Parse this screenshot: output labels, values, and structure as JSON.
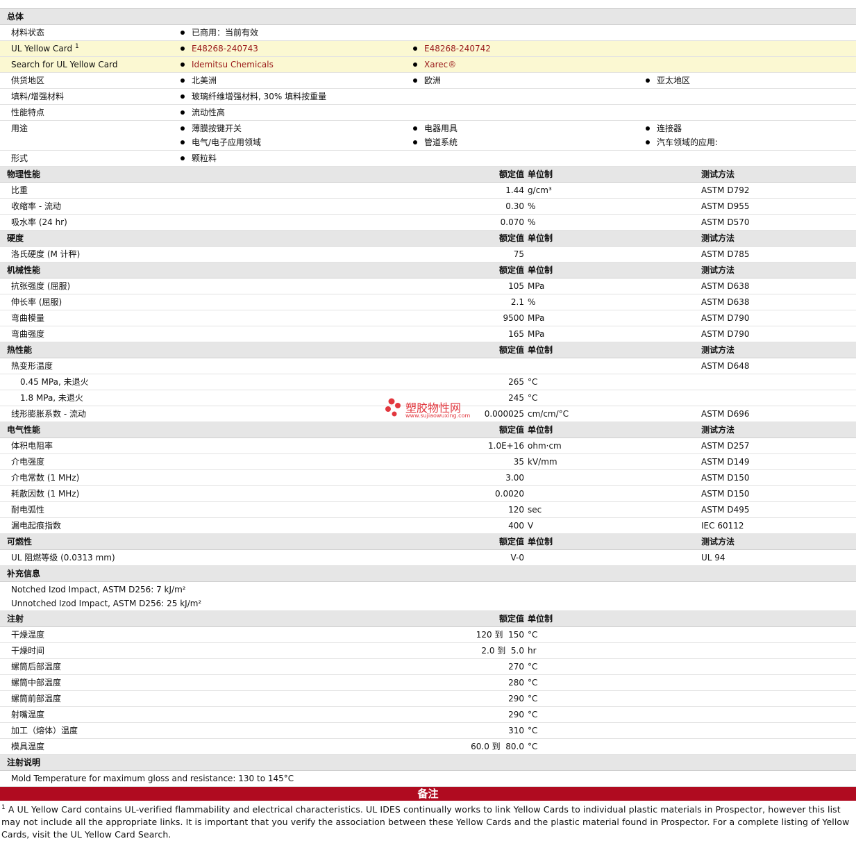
{
  "general": {
    "title": "总体",
    "material_status_label": "材料状态",
    "material_status": "已商用：当前有效",
    "ul_card_label": "UL Yellow Card",
    "ul_card_sup": "1",
    "ul_card_1": "E48268-240743",
    "ul_card_2": "E48268-240742",
    "search_label": "Search for UL Yellow Card",
    "search_1": "Idemitsu Chemicals",
    "search_2": "Xarec®",
    "supply_label": "供货地区",
    "supply": [
      "北美洲",
      "欧洲",
      "亚太地区"
    ],
    "filler_label": "填料/增强材料",
    "filler": "玻璃纤维增强材料, 30% 填料按重量",
    "features_label": "性能特点",
    "features": "流动性高",
    "uses_label": "用途",
    "uses": [
      "薄膜按键开关",
      "电器用具",
      "连接器",
      "电气/电子应用领域",
      "管道系统",
      "汽车领域的应用:"
    ],
    "form_label": "形式",
    "form": "颗粒料"
  },
  "headers": {
    "value": "额定值",
    "unit": "单位制",
    "method": "测试方法"
  },
  "physical": {
    "title": "物理性能",
    "rows": [
      {
        "name": "比重",
        "value": "1.44",
        "unit": "g/cm³",
        "method": "ASTM D792"
      },
      {
        "name": "收缩率 - 流动",
        "value": "0.30",
        "unit": "%",
        "method": "ASTM D955"
      },
      {
        "name": "吸水率 (24 hr)",
        "value": "0.070",
        "unit": "%",
        "method": "ASTM D570"
      }
    ]
  },
  "hardness": {
    "title": "硬度",
    "rows": [
      {
        "name": "洛氏硬度 (M 计秤)",
        "value": "75",
        "unit": "",
        "method": "ASTM D785"
      }
    ]
  },
  "mechanical": {
    "title": "机械性能",
    "rows": [
      {
        "name": "抗张强度 (屈服)",
        "value": "105",
        "unit": "MPa",
        "method": "ASTM D638"
      },
      {
        "name": "伸长率 (屈服)",
        "value": "2.1",
        "unit": "%",
        "method": "ASTM D638"
      },
      {
        "name": "弯曲模量",
        "value": "9500",
        "unit": "MPa",
        "method": "ASTM D790"
      },
      {
        "name": "弯曲强度",
        "value": "165",
        "unit": "MPa",
        "method": "ASTM D790"
      }
    ]
  },
  "thermal": {
    "title": "热性能",
    "hdt_label": "热变形温度",
    "hdt_method": "ASTM D648",
    "hdt_rows": [
      {
        "name": "0.45 MPa, 未退火",
        "value": "265",
        "unit": "°C"
      },
      {
        "name": "1.8 MPa, 未退火",
        "value": "245",
        "unit": "°C"
      }
    ],
    "clte": {
      "name": "线形膨胀系数 - 流动",
      "value": "0.000025",
      "unit": "cm/cm/°C",
      "method": "ASTM D696"
    }
  },
  "electrical": {
    "title": "电气性能",
    "rows": [
      {
        "name": "体积电阻率",
        "value": "1.0E+16",
        "unit": "ohm·cm",
        "method": "ASTM D257"
      },
      {
        "name": "介电强度",
        "value": "35",
        "unit": "kV/mm",
        "method": "ASTM D149"
      },
      {
        "name": "介电常数 (1 MHz)",
        "value": "3.00",
        "unit": "",
        "method": "ASTM D150"
      },
      {
        "name": "耗散因数 (1 MHz)",
        "value": "0.0020",
        "unit": "",
        "method": "ASTM D150"
      },
      {
        "name": "耐电弧性",
        "value": "120",
        "unit": "sec",
        "method": "ASTM D495"
      },
      {
        "name": "漏电起痕指数",
        "value": "400",
        "unit": "V",
        "method": "IEC 60112"
      }
    ]
  },
  "flammability": {
    "title": "可燃性",
    "rows": [
      {
        "name": "UL 阻燃等级 (0.0313 mm)",
        "value": "V-0",
        "unit": "",
        "method": "UL 94"
      }
    ]
  },
  "supplemental": {
    "title": "补充信息",
    "lines": [
      "Notched Izod Impact, ASTM D256: 7 kJ/m²",
      "Unnotched Izod Impact, ASTM D256: 25 kJ/m²"
    ]
  },
  "injection": {
    "title": "注射",
    "rows": [
      {
        "name": "干燥温度",
        "value": "120 到  150",
        "unit": "°C"
      },
      {
        "name": "干燥时间",
        "value": "2.0 到  5.0",
        "unit": "hr"
      },
      {
        "name": "螺筒后部温度",
        "value": "270",
        "unit": "°C"
      },
      {
        "name": "螺筒中部温度",
        "value": "280",
        "unit": "°C"
      },
      {
        "name": "螺筒前部温度",
        "value": "290",
        "unit": "°C"
      },
      {
        "name": "射嘴温度",
        "value": "290",
        "unit": "°C"
      },
      {
        "name": "加工（熔体）温度",
        "value": "310",
        "unit": "°C"
      },
      {
        "name": "模具温度",
        "value": "60.0 到  80.0",
        "unit": "°C"
      }
    ]
  },
  "injection_notes": {
    "title": "注射说明",
    "text": "Mold Temperature for maximum gloss and resistance: 130 to 145°C"
  },
  "notes": {
    "title": "备注",
    "sup": "1",
    "text": " A UL Yellow Card contains UL-verified flammability and electrical characteristics. UL IDES continually works to link Yellow Cards to individual plastic materials in Prospector, however this list may not include all the appropriate links. It is important that you verify the association between these Yellow Cards and the plastic material found in Prospector. For a complete listing of Yellow Cards, visit the UL Yellow Card Search."
  },
  "watermark": {
    "text": "塑胶物性网",
    "url": "www.sujiaowuxing.com"
  },
  "colors": {
    "section_bg": "#e6e6e6",
    "highlight_bg": "#fbf8d2",
    "link": "#9a1a1a",
    "notes_bar": "#b00b20"
  }
}
